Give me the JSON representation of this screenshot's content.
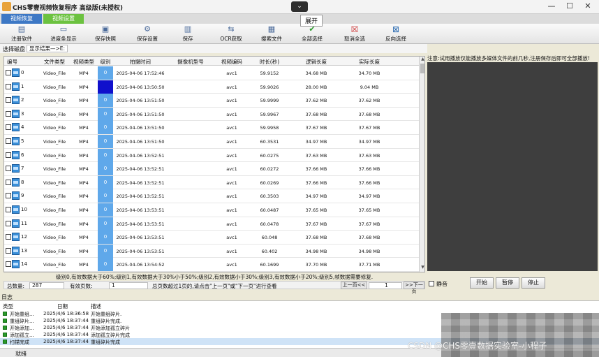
{
  "window": {
    "title": "CHS零壹视频恢复程序 高级版(未授权)",
    "collapse_symbol": "⌄",
    "collapse_tooltip": "展开",
    "minimize": "—",
    "maximize": "☐",
    "close": "✕"
  },
  "tabs": [
    "视频恢复",
    "视频设置"
  ],
  "toolbar": [
    {
      "label": "注册软件",
      "icon": "register-icon"
    },
    {
      "label": "进度条显示",
      "icon": "progress-icon"
    },
    {
      "label": "保存快照",
      "icon": "snapshot-icon"
    },
    {
      "label": "保存设置",
      "icon": "settings-save-icon"
    },
    {
      "label": "保存",
      "icon": "save-icon"
    },
    {
      "label": "OCR获取",
      "icon": "ocr-icon"
    },
    {
      "label": "搜索文件",
      "icon": "search-file-icon"
    },
    {
      "label": "全部选择",
      "icon": "checkmark-icon"
    },
    {
      "label": "取消全选",
      "icon": "red-x-icon"
    },
    {
      "label": "反向选择",
      "icon": "invert-selection-icon"
    }
  ],
  "pathbar": {
    "select_disk": "选择磁盘",
    "result_label": "显示结果—>E:"
  },
  "table": {
    "columns": [
      "编号",
      "文件类型",
      "视频类型",
      "级别",
      "拍摄时间",
      "摄像机型号",
      "视频编码",
      "时长(秒)",
      "逻辑长度",
      "实际长度"
    ],
    "rows": [
      [
        "0",
        "Video_File",
        "MP4",
        "0",
        "2025-04-06 17:52:46",
        "",
        "avc1",
        "59.9152",
        "34.68 MB",
        "34.70 MB"
      ],
      [
        "1",
        "Video_File",
        "MP4",
        "",
        "2025-04-06 13:50:50",
        "",
        "avc1",
        "59.9026",
        "28.00 MB",
        "9.04 MB"
      ],
      [
        "2",
        "Video_File",
        "MP4",
        "0",
        "2025-04-06 13:51:50",
        "",
        "avc1",
        "59.9999",
        "37.62 MB",
        "37.62 MB"
      ],
      [
        "3",
        "Video_File",
        "MP4",
        "0",
        "2025-04-06 13:51:50",
        "",
        "avc1",
        "59.9967",
        "37.68 MB",
        "37.68 MB"
      ],
      [
        "4",
        "Video_File",
        "MP4",
        "0",
        "2025-04-06 13:51:50",
        "",
        "avc1",
        "59.9958",
        "37.67 MB",
        "37.67 MB"
      ],
      [
        "5",
        "Video_File",
        "MP4",
        "0",
        "2025-04-06 13:51:50",
        "",
        "avc1",
        "60.3531",
        "34.97 MB",
        "34.97 MB"
      ],
      [
        "6",
        "Video_File",
        "MP4",
        "0",
        "2025-04-06 13:52:51",
        "",
        "avc1",
        "60.0275",
        "37.63 MB",
        "37.63 MB"
      ],
      [
        "7",
        "Video_File",
        "MP4",
        "0",
        "2025-04-06 13:52:51",
        "",
        "avc1",
        "60.0272",
        "37.66 MB",
        "37.66 MB"
      ],
      [
        "8",
        "Video_File",
        "MP4",
        "0",
        "2025-04-06 13:52:51",
        "",
        "avc1",
        "60.0269",
        "37.66 MB",
        "37.66 MB"
      ],
      [
        "9",
        "Video_File",
        "MP4",
        "0",
        "2025-04-06 13:52:51",
        "",
        "avc1",
        "60.3503",
        "34.97 MB",
        "34.97 MB"
      ],
      [
        "10",
        "Video_File",
        "MP4",
        "0",
        "2025-04-06 13:53:51",
        "",
        "avc1",
        "60.0487",
        "37.65 MB",
        "37.65 MB"
      ],
      [
        "11",
        "Video_File",
        "MP4",
        "0",
        "2025-04-06 13:53:51",
        "",
        "avc1",
        "60.0478",
        "37.67 MB",
        "37.67 MB"
      ],
      [
        "12",
        "Video_File",
        "MP4",
        "0",
        "2025-04-06 13:53:51",
        "",
        "avc1",
        "60.048",
        "37.68 MB",
        "37.68 MB"
      ],
      [
        "13",
        "Video_File",
        "MP4",
        "0",
        "2025-04-06 13:53:51",
        "",
        "avc1",
        "60.402",
        "34.98 MB",
        "34.98 MB"
      ],
      [
        "14",
        "Video_File",
        "MP4",
        "0",
        "2025-04-06 13:54:52",
        "",
        "avc1",
        "60.1699",
        "37.70 MB",
        "37.71 MB"
      ]
    ],
    "level_colors": {
      "normal": "#5fa8ea",
      "dark": "#1010cc"
    }
  },
  "level_legend": "级别0,有效数据大于60%;级别1,有效数据大于30%小于50%;级别2,有效数据小于30%;级别3,有效数据小于20%;级别5,帧数据需要修复.",
  "statusline": {
    "total_label": "总数量:",
    "total_value": "287",
    "pages_label": "有效页数:",
    "pages_value": "1",
    "hint": "总页数超过1页的,请点击\"上一页\"或\"下一页\"进行查看",
    "prev_page": "上一页<<",
    "page_input": "1",
    "next_page": ">>下一页"
  },
  "preview": {
    "note": "注意:试用播放仅能播放多媒体文件的前几秒,注册保存后即可全部播放!",
    "mute_label": "静音",
    "start": "开始",
    "pause": "暂停",
    "stop": "停止"
  },
  "log": {
    "title": "日志",
    "columns": [
      "类型",
      "日期",
      "描述"
    ],
    "rows": [
      {
        "type": "开始重组...",
        "date": "2025/4/6 18:36:58",
        "desc": "开始重组碎片."
      },
      {
        "type": "重组碎片...",
        "date": "2025/4/6 18:37:44",
        "desc": "重组碎片完成."
      },
      {
        "type": "开始添加...",
        "date": "2025/4/6 18:37:44",
        "desc": "开始添加孤立碎片"
      },
      {
        "type": "添加孤立...",
        "date": "2025/4/6 18:37:44",
        "desc": "添加孤立碎片完成"
      },
      {
        "type": "扫描完成",
        "date": "2025/4/6 18:37:44",
        "desc": "重组碎片完成"
      }
    ]
  },
  "status": {
    "text": "就绪"
  },
  "watermark": "CSDN @CHS零壹数据实验室-小程子"
}
